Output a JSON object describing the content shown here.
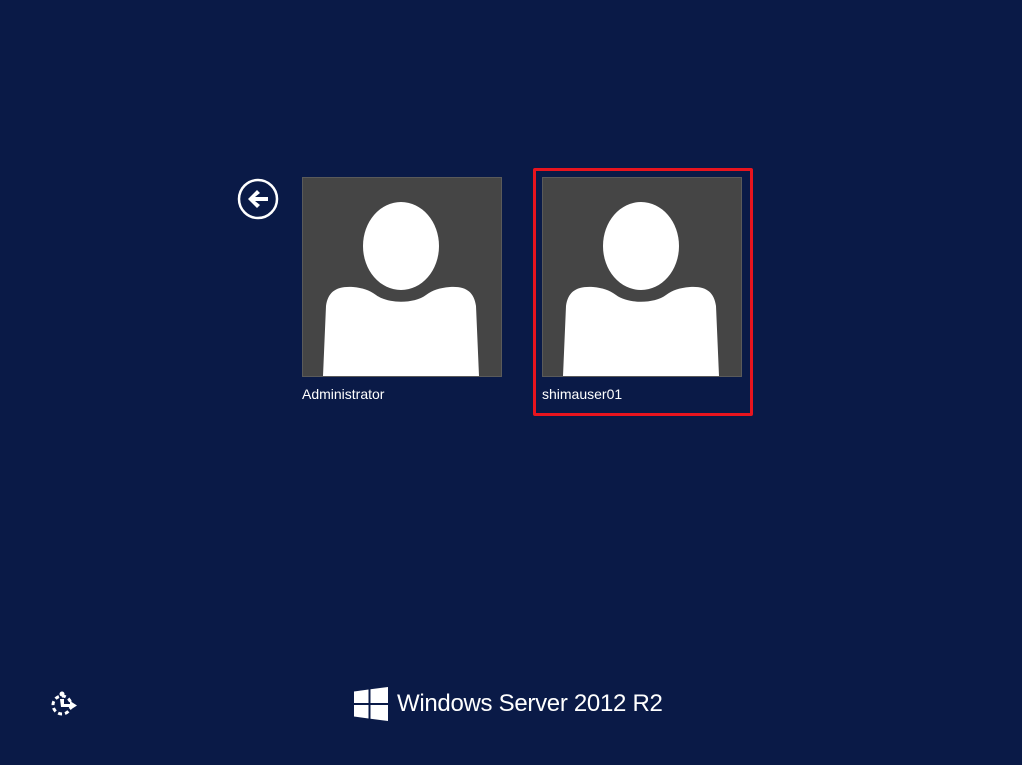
{
  "screen": {
    "background_color": "#0a1a47"
  },
  "back_button": {
    "icon": "back-arrow-icon"
  },
  "users": [
    {
      "name": "Administrator",
      "avatar_icon": "user-silhouette-icon",
      "highlighted": false
    },
    {
      "name": "shimauser01",
      "avatar_icon": "user-silhouette-icon",
      "highlighted": true
    }
  ],
  "highlight_color": "#e8141e",
  "ease_of_access": {
    "icon": "ease-of-access-icon"
  },
  "branding": {
    "logo_icon": "windows-logo-icon",
    "product_name": "Windows Server 2012 R2"
  }
}
